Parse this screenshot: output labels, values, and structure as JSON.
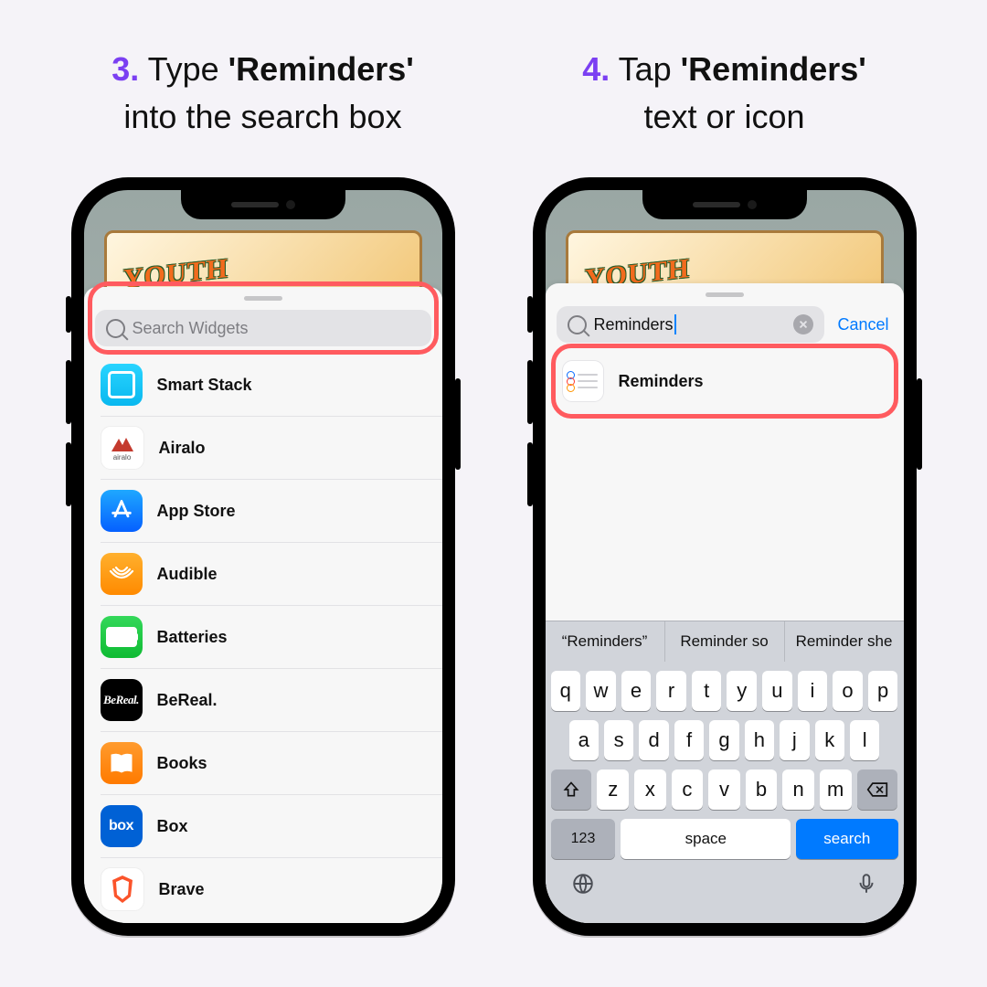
{
  "steps": {
    "s3": {
      "num": "3.",
      "pre": " Type ",
      "bold": "'Reminders'",
      "post": " into the search box"
    },
    "s4": {
      "num": "4.",
      "pre": " Tap ",
      "bold": "'Reminders'",
      "post": " text or icon"
    }
  },
  "phone1": {
    "search_placeholder": "Search Widgets",
    "wallpaper_text": "YOUTH",
    "list": [
      {
        "label": "Smart Stack"
      },
      {
        "label": "Airalo",
        "sub": "airalo"
      },
      {
        "label": "App Store"
      },
      {
        "label": "Audible"
      },
      {
        "label": "Batteries"
      },
      {
        "label": "BeReal."
      },
      {
        "label": "Books"
      },
      {
        "label": "Box"
      },
      {
        "label": "Brave"
      }
    ]
  },
  "phone2": {
    "search_value": "Reminders",
    "cancel": "Cancel",
    "wallpaper_text": "YOUTH",
    "result": {
      "label": "Reminders"
    },
    "predictions": [
      "“Reminders”",
      "Reminder so",
      "Reminder she"
    ],
    "keyboard": {
      "row1": [
        "q",
        "w",
        "e",
        "r",
        "t",
        "y",
        "u",
        "i",
        "o",
        "p"
      ],
      "row2": [
        "a",
        "s",
        "d",
        "f",
        "g",
        "h",
        "j",
        "k",
        "l"
      ],
      "row3": [
        "z",
        "x",
        "c",
        "v",
        "b",
        "n",
        "m"
      ],
      "num": "123",
      "space": "space",
      "search": "search"
    }
  }
}
